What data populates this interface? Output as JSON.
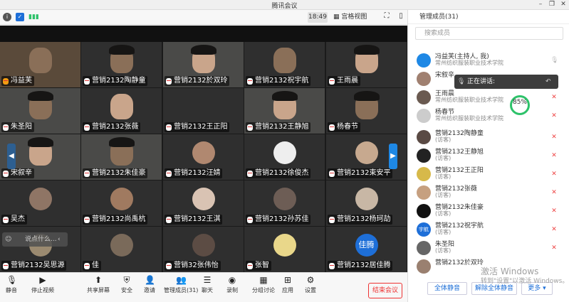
{
  "window": {
    "title": "腾讯会议"
  },
  "toolbar": {
    "time": "18:49",
    "gallery_view": "宫格视图"
  },
  "tiles": [
    {
      "name": "冯益芙",
      "host": true
    },
    {
      "name": "营销2132陶静童"
    },
    {
      "name": "营销2132於双玲"
    },
    {
      "name": "营销2132祝宇航"
    },
    {
      "name": "王雨晨"
    },
    {
      "name": "朱圣阳"
    },
    {
      "name": "营销2132张薇"
    },
    {
      "name": "营销2132王正阳"
    },
    {
      "name": "营销2132王静旭"
    },
    {
      "name": "杨春节"
    },
    {
      "name": "宋叙辛"
    },
    {
      "name": "营销2132朱佳豪"
    },
    {
      "name": "营销2132汪婧"
    },
    {
      "name": "营销2132徐俊杰"
    },
    {
      "name": "营销2132束安平"
    },
    {
      "name": "吴杰"
    },
    {
      "name": "营销2132尚禹杭"
    },
    {
      "name": "营销2132王淇"
    },
    {
      "name": "营销2132孙苏佳"
    },
    {
      "name": "营销2132杨珂劼"
    },
    {
      "name": "营销2132吴思源"
    },
    {
      "name": "佳"
    },
    {
      "name": "营销32张伟怡"
    },
    {
      "name": "张智"
    },
    {
      "name": "营销2132居佳腾"
    }
  ],
  "tile_avatar_text": "佳腾",
  "chat_bubble": {
    "placeholder": "说点什么..."
  },
  "bottom_bar": {
    "mute": "静音",
    "stop_video": "停止视频",
    "share_screen": "共享屏幕",
    "security": "安全",
    "invite": "邀请",
    "manage_members": "管理成员(31)",
    "chat": "聊天",
    "record": "录制",
    "breakout": "分组讨论",
    "apps": "应用",
    "settings": "设置",
    "end_meeting": "结束会议"
  },
  "panel": {
    "title": "管理成员(31)",
    "search_placeholder": "搜索成员",
    "speaking_label": "正在讲话:",
    "net_percent": "85%",
    "members": [
      {
        "name": "冯益芙(主持人, 我)",
        "sub": "常州纺织服装职业技术学院"
      },
      {
        "name": "宋叙辛",
        "sub": ""
      },
      {
        "name": "王雨晨",
        "sub": "常州纺织服装职业技术学院"
      },
      {
        "name": "杨春节",
        "sub": "常州纺织服装职业技术学院"
      },
      {
        "name": "营销2132陶静童",
        "sub": "(访客)"
      },
      {
        "name": "营销2132王静旭",
        "sub": "(访客)"
      },
      {
        "name": "营销2132王正阳",
        "sub": "(访客)"
      },
      {
        "name": "营销2132张薇",
        "sub": "(访客)"
      },
      {
        "name": "营销2132朱佳豪",
        "sub": "(访客)"
      },
      {
        "name": "营销2132祝宇航",
        "sub": "(访客)"
      },
      {
        "name": "朱圣阳",
        "sub": "(访客)"
      },
      {
        "name": "营销2132於双玲",
        "sub": ""
      }
    ],
    "member_avatar_text": "宇航",
    "buttons": {
      "mute_all": "全体静音",
      "unmute_all": "解除全体静音",
      "more": "更多"
    }
  },
  "watermark": {
    "line1": "激活 Windows",
    "line2": "转到\"设置\"以激活 Windows。"
  },
  "colors": {
    "accent": "#1e88e5",
    "danger": "#e33333",
    "ok": "#2ec26a"
  }
}
